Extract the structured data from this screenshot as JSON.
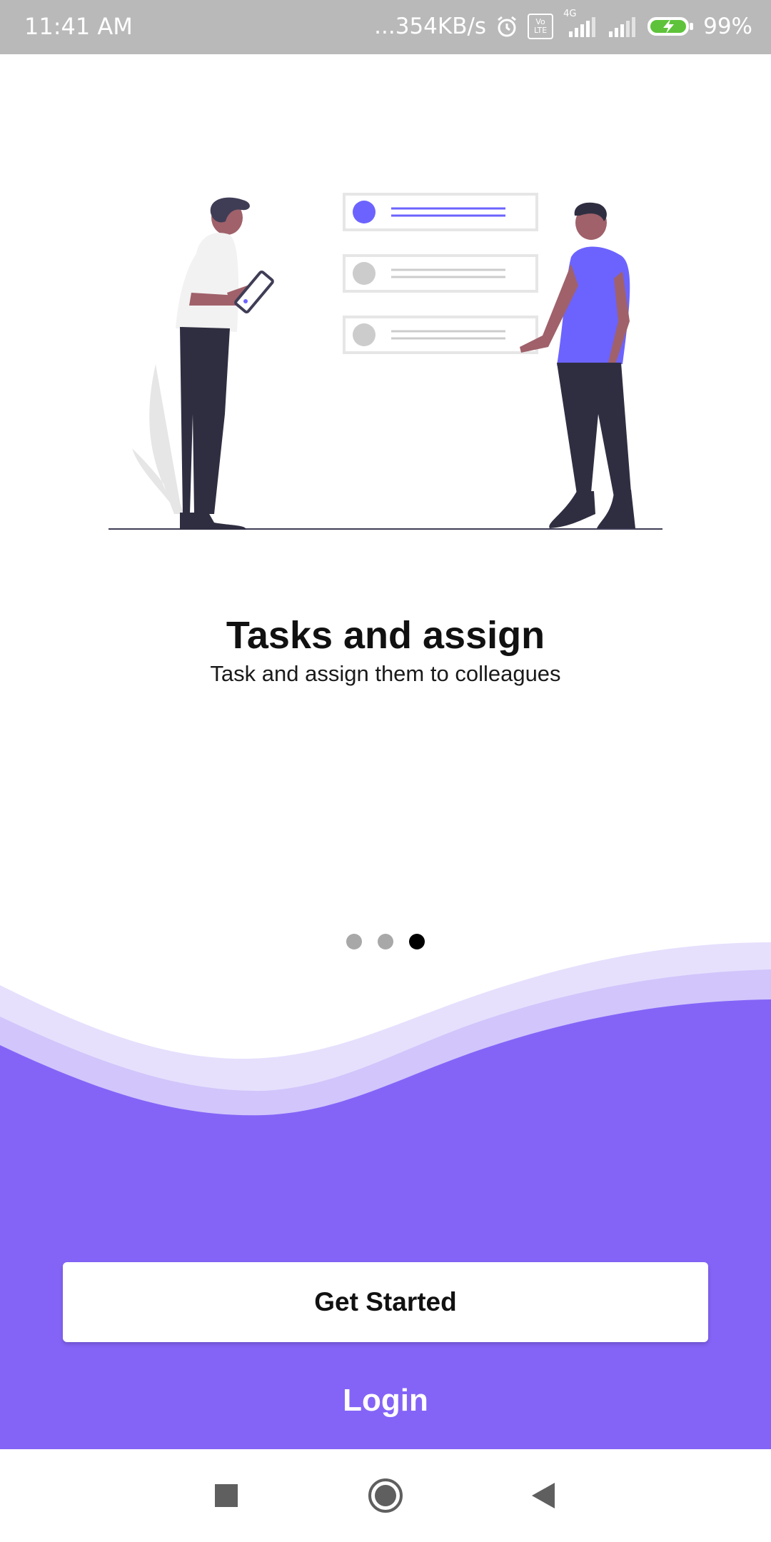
{
  "status_bar": {
    "time": "11:41 AM",
    "network_speed": "...354KB/s",
    "network_type": "4G",
    "volte": "Vo LTE",
    "battery": "99%"
  },
  "onboarding": {
    "title": "Tasks and assign",
    "subtitle": "Task and assign them to colleagues",
    "page_indicator": {
      "total": 3,
      "current": 3
    }
  },
  "actions": {
    "get_started": "Get Started",
    "login": "Login"
  },
  "nav_bar": {
    "recents_icon": "square-icon",
    "home_icon": "circle-icon",
    "back_icon": "triangle-back-icon"
  },
  "colors": {
    "accent": "#8464f7",
    "wave_light": "#e6e0fd",
    "wave_mid": "#d1c5fb",
    "illustration_accent": "#6c63ff"
  }
}
